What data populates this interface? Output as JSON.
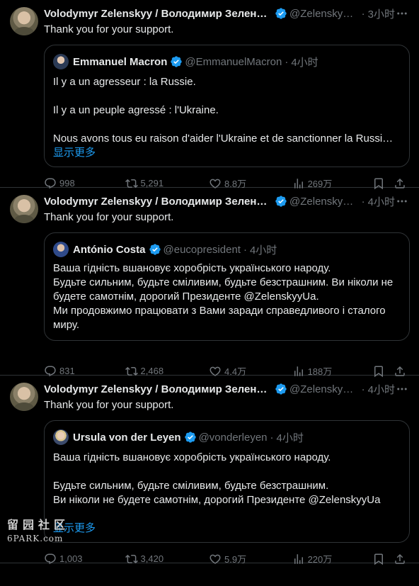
{
  "tweets": [
    {
      "author_name": "Volodymyr Zelenskyy / Володимир Зеленс…",
      "handle": "@Zelensky…",
      "time": "3小时",
      "text": "Thank you for your support.",
      "quote": {
        "author_name": "Emmanuel Macron",
        "handle": "@EmmanuelMacron",
        "time": "4小时",
        "lines": [
          "Il y a un agresseur : la Russie.",
          "",
          "Il y a un peuple agressé : l'Ukraine.",
          "",
          "Nous avons tous eu raison d'aider l'Ukraine et de sanctionner la Russi…"
        ],
        "show_more": "显示更多"
      },
      "metrics": {
        "replies": "998",
        "reposts": "5,291",
        "likes": "8.8万",
        "views": "269万"
      }
    },
    {
      "author_name": "Volodymyr Zelenskyy / Володимир Зеленс…",
      "handle": "@Zelensky…",
      "time": "4小时",
      "text": "Thank you for your support.",
      "quote": {
        "author_name": "António Costa",
        "handle": "@eucopresident",
        "time": "4小时",
        "lines": [
          "Ваша гідність вшановує хоробрість українського народу.",
          "Будьте сильним, будьте сміливим, будьте безстрашним. Ви ніколи не",
          "будете самотнім, дорогий Президенте @ZelenskyyUa.",
          "Ми продовжимо працювати з Вами заради справедливого і сталого",
          "миру."
        ],
        "show_more": ""
      },
      "metrics": {
        "replies": "831",
        "reposts": "2,468",
        "likes": "4.4万",
        "views": "188万"
      }
    },
    {
      "author_name": "Volodymyr Zelenskyy / Володимир Зеленс…",
      "handle": "@Zelensky…",
      "time": "4小时",
      "text": "Thank you for your support.",
      "quote": {
        "author_name": "Ursula von der Leyen",
        "handle": "@vonderleyen",
        "time": "4小时",
        "lines": [
          "Ваша гідність вшановує хоробрість українського народу.",
          "",
          "Будьте сильним, будьте сміливим, будьте безстрашним.",
          "Ви ніколи не будете самотнім, дорогий Президенте @ZelenskyyUa",
          ""
        ],
        "show_more": "显示更多"
      },
      "metrics": {
        "replies": "1,003",
        "reposts": "3,420",
        "likes": "5.9万",
        "views": "220万"
      }
    }
  ],
  "watermark": {
    "line1": "留园社区",
    "line2": "6PARK.com"
  },
  "colors": {
    "background": "#000000",
    "text": "#e7e9ea",
    "muted": "#71767b",
    "link": "#1d9bf0",
    "verified": "#1d9bf0",
    "border": "#2f3336"
  },
  "icons": [
    "verified-badge-icon",
    "more-icon",
    "reply-icon",
    "repost-icon",
    "like-icon",
    "views-icon",
    "bookmark-icon",
    "share-icon"
  ]
}
